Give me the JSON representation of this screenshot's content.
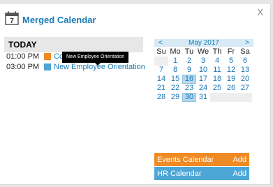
{
  "window": {
    "title": "Merged Calendar",
    "close_label": "X",
    "icon_day": "7"
  },
  "agenda": {
    "header": "TODAY",
    "events": [
      {
        "time": "01:00 PM",
        "title": "Co",
        "color": "#f08a24"
      },
      {
        "time": "03:00 PM",
        "title": "New Employee Orientation",
        "color": "#4da6d6"
      }
    ],
    "tooltip": "New Employee Orientation"
  },
  "mini_calendar": {
    "prev_label": "<",
    "month_label": "May 2017",
    "next_label": ">",
    "weekdays": [
      "Su",
      "Mo",
      "Tu",
      "We",
      "Th",
      "Fr",
      "Sa"
    ],
    "weeks": [
      [
        "",
        "1",
        "2",
        "3",
        "4",
        "5",
        "6"
      ],
      [
        "7",
        "8",
        "9",
        "10",
        "11",
        "12",
        "13"
      ],
      [
        "14",
        "15",
        "16",
        "17",
        "18",
        "19",
        "20"
      ],
      [
        "21",
        "22",
        "23",
        "24",
        "25",
        "26",
        "27"
      ],
      [
        "28",
        "29",
        "30",
        "31",
        "",
        "",
        ""
      ]
    ],
    "highlighted": [
      "16",
      "30"
    ]
  },
  "calendars": [
    {
      "name": "Events Calendar",
      "action": "Add",
      "color": "#f08a24"
    },
    {
      "name": "HR Calendar",
      "action": "Add",
      "color": "#4da6d6"
    }
  ]
}
